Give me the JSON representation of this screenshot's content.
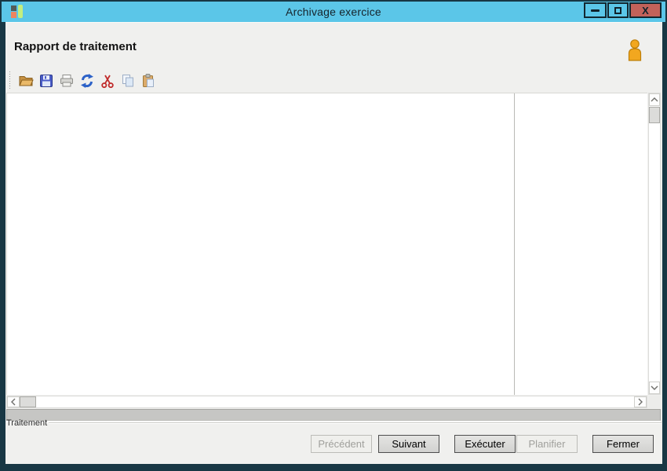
{
  "window": {
    "title": "Archivage exercice",
    "controls": {
      "minimize": "minimize",
      "maximize": "maximize",
      "close_glyph": "X"
    }
  },
  "header": {
    "title": "Rapport de traitement",
    "user_icon": "user-icon"
  },
  "toolbar": {
    "icons": [
      "open-folder-icon",
      "save-icon",
      "print-icon",
      "refresh-icon",
      "cut-icon",
      "copy-icon",
      "paste-icon"
    ]
  },
  "treatment_group": {
    "label": "Traitement"
  },
  "footer": {
    "buttons": [
      {
        "label": "Précédent",
        "enabled": false
      },
      {
        "label": "Suivant",
        "enabled": true
      },
      {
        "label": "Exécuter",
        "enabled": true
      },
      {
        "label": "Planifier",
        "enabled": false
      },
      {
        "label": "Fermer",
        "enabled": true
      }
    ]
  },
  "colors": {
    "titlebar_blue": "#5bc6e8",
    "frame_dark": "#183744",
    "close_red": "#c2625a",
    "body_background": "#f0f0ee",
    "content_white": "#ffffff",
    "user_icon_orange": "#f2a71f"
  }
}
